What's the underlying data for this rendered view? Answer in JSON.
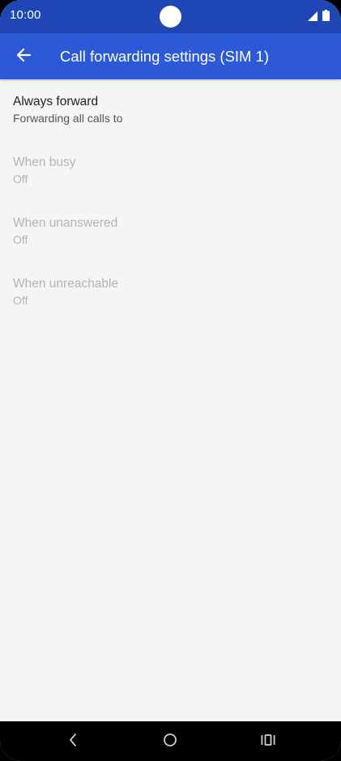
{
  "status_bar": {
    "time": "10:00",
    "icons": [
      "signal-icon",
      "battery-icon"
    ]
  },
  "app_bar": {
    "back_icon": "arrow-left-icon",
    "title": "Call forwarding settings (SIM 1)"
  },
  "settings": [
    {
      "title": "Always forward",
      "summary": "Forwarding all calls to",
      "enabled": true
    },
    {
      "title": "When busy",
      "summary": "Off",
      "enabled": false
    },
    {
      "title": "When unanswered",
      "summary": "Off",
      "enabled": false
    },
    {
      "title": "When unreachable",
      "summary": "Off",
      "enabled": false
    }
  ],
  "nav_bar": {
    "icons": [
      "back-chevron-icon",
      "home-circle-icon",
      "recents-icon"
    ]
  },
  "colors": {
    "status_bar": "#1e46b4",
    "app_bar": "#2b59d8",
    "background": "#f5f5f5",
    "disabled_text": "#b3b3b3"
  }
}
